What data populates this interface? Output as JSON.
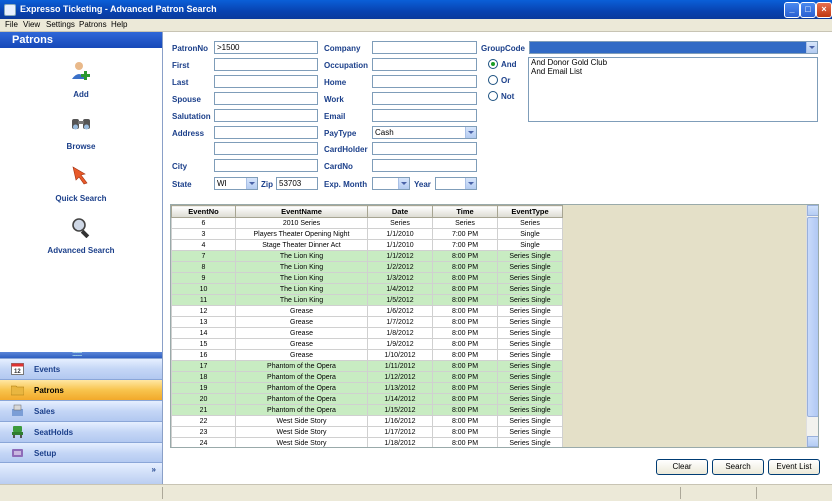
{
  "window": {
    "title": "Expresso Ticketing - Advanced Patron Search"
  },
  "menu": [
    "File",
    "View",
    "Settings",
    "Patrons",
    "Help"
  ],
  "left_panel": {
    "header": "Patrons",
    "tiles": [
      {
        "label": "Add",
        "icon": "add-user-icon"
      },
      {
        "label": "Browse",
        "icon": "binoculars-icon"
      },
      {
        "label": "Quick Search",
        "icon": "quick-search-arrow-icon"
      },
      {
        "label": "Advanced Search",
        "icon": "magnifier-icon"
      }
    ],
    "stack": [
      {
        "label": "Events",
        "icon": "calendar-icon",
        "active": false
      },
      {
        "label": "Patrons",
        "icon": "patrons-folder-icon",
        "active": true
      },
      {
        "label": "Sales",
        "icon": "sales-icon",
        "active": false
      },
      {
        "label": "SeatHolds",
        "icon": "seatholds-icon",
        "active": false
      },
      {
        "label": "Setup",
        "icon": "setup-icon",
        "active": false
      }
    ],
    "more": "»"
  },
  "form": {
    "patronno": {
      "label": "PatronNo",
      "value": ">1500"
    },
    "first": {
      "label": "First",
      "value": ""
    },
    "last": {
      "label": "Last",
      "value": ""
    },
    "spouse": {
      "label": "Spouse",
      "value": ""
    },
    "salutation": {
      "label": "Salutation",
      "value": ""
    },
    "address": {
      "label": "Address",
      "value": ""
    },
    "address2": {
      "value": ""
    },
    "city": {
      "label": "City",
      "value": ""
    },
    "state": {
      "label": "State",
      "value": "WI"
    },
    "zip": {
      "label": "Zip",
      "value": "53703"
    },
    "company": {
      "label": "Company",
      "value": ""
    },
    "occupation": {
      "label": "Occupation",
      "value": ""
    },
    "home": {
      "label": "Home",
      "value": ""
    },
    "work": {
      "label": "Work",
      "value": ""
    },
    "email": {
      "label": "Email",
      "value": ""
    },
    "paytype": {
      "label": "PayType",
      "value": "Cash"
    },
    "cardholder": {
      "label": "CardHolder",
      "value": ""
    },
    "cardno": {
      "label": "CardNo",
      "value": ""
    },
    "expmonth": {
      "label": "Exp. Month",
      "value": ""
    },
    "year": {
      "label": "Year",
      "value": ""
    },
    "groupcode": {
      "label": "GroupCode",
      "value": ""
    },
    "logic": {
      "and": "And",
      "or": "Or",
      "not": "Not",
      "selected": "and"
    },
    "group_list": [
      "And Donor Gold Club",
      "And Email List"
    ]
  },
  "grid": {
    "columns": [
      "EventNo",
      "EventName",
      "Date",
      "Time",
      "EventType"
    ],
    "rows": [
      [
        "6",
        "2010 Series",
        "Series",
        "Series",
        "Series",
        false
      ],
      [
        "3",
        "Players Theater Opening Night",
        "1/1/2010",
        "7:00 PM",
        "Single",
        false
      ],
      [
        "4",
        "Stage Theater Dinner Act",
        "1/1/2010",
        "7:00 PM",
        "Single",
        false
      ],
      [
        "7",
        "The Lion King",
        "1/1/2012",
        "8:00 PM",
        "Series Single",
        true
      ],
      [
        "8",
        "The Lion King",
        "1/2/2012",
        "8:00 PM",
        "Series Single",
        true
      ],
      [
        "9",
        "The Lion King",
        "1/3/2012",
        "8:00 PM",
        "Series Single",
        true
      ],
      [
        "10",
        "The Lion King",
        "1/4/2012",
        "8:00 PM",
        "Series Single",
        true
      ],
      [
        "11",
        "The Lion King",
        "1/5/2012",
        "8:00 PM",
        "Series Single",
        true
      ],
      [
        "12",
        "Grease",
        "1/6/2012",
        "8:00 PM",
        "Series Single",
        false
      ],
      [
        "13",
        "Grease",
        "1/7/2012",
        "8:00 PM",
        "Series Single",
        false
      ],
      [
        "14",
        "Grease",
        "1/8/2012",
        "8:00 PM",
        "Series Single",
        false
      ],
      [
        "15",
        "Grease",
        "1/9/2012",
        "8:00 PM",
        "Series Single",
        false
      ],
      [
        "16",
        "Grease",
        "1/10/2012",
        "8:00 PM",
        "Series Single",
        false
      ],
      [
        "17",
        "Phantom of the Opera",
        "1/11/2012",
        "8:00 PM",
        "Series Single",
        true
      ],
      [
        "18",
        "Phantom of the Opera",
        "1/12/2012",
        "8:00 PM",
        "Series Single",
        true
      ],
      [
        "19",
        "Phantom of the Opera",
        "1/13/2012",
        "8:00 PM",
        "Series Single",
        true
      ],
      [
        "20",
        "Phantom of the Opera",
        "1/14/2012",
        "8:00 PM",
        "Series Single",
        true
      ],
      [
        "21",
        "Phantom of the Opera",
        "1/15/2012",
        "8:00 PM",
        "Series Single",
        true
      ],
      [
        "22",
        "West Side Story",
        "1/16/2012",
        "8:00 PM",
        "Series Single",
        false
      ],
      [
        "23",
        "West Side Story",
        "1/17/2012",
        "8:00 PM",
        "Series Single",
        false
      ],
      [
        "24",
        "West Side Story",
        "1/18/2012",
        "8:00 PM",
        "Series Single",
        false
      ]
    ]
  },
  "buttons": {
    "clear": "Clear",
    "search": "Search",
    "event_list": "Event List"
  },
  "colors": {
    "title_bar": "#0842b0",
    "row_highlight": "#c8ecc2",
    "active_stack": "#f8c44e"
  }
}
